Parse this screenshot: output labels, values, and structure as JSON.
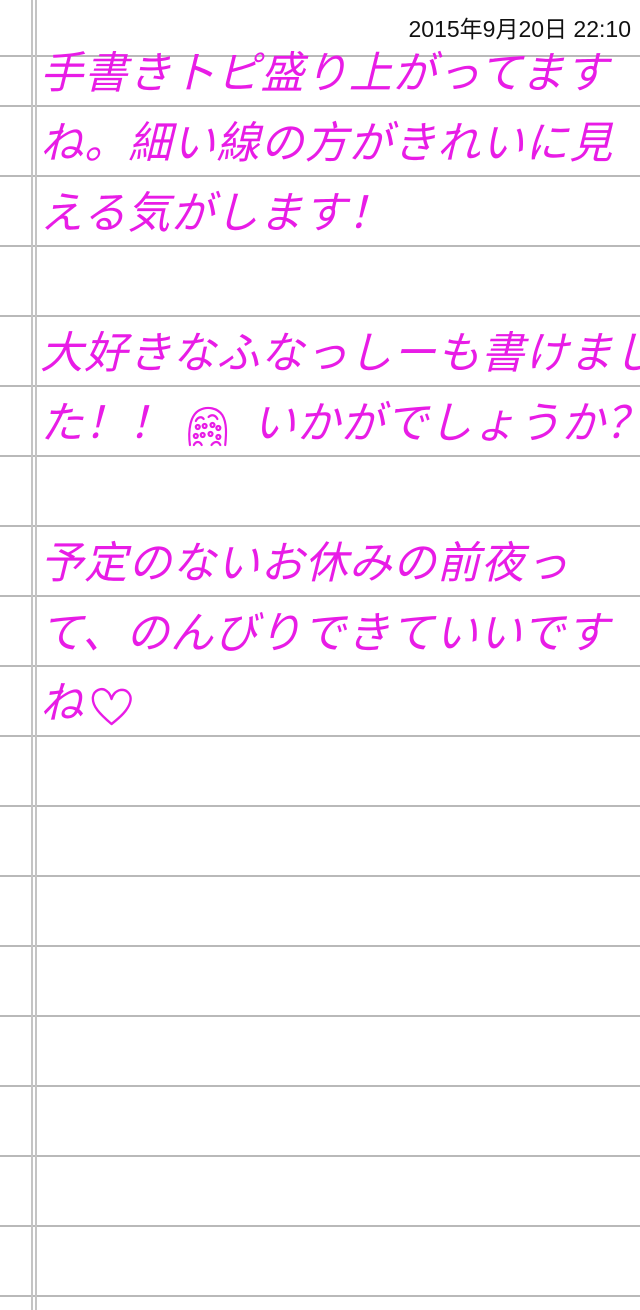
{
  "header": {
    "timestamp": "2015年9月20日 22:10"
  },
  "note": {
    "ink_color": "#e81ce6",
    "paragraph1": {
      "line1": "手書きトピ盛り上がってます",
      "line2": "ね。細い線の方がきれいに見",
      "line3": "える気がします！"
    },
    "paragraph2": {
      "line1": "大好きなふなっしーも書けまし",
      "line2_before_icon": "た！！",
      "line2_icon": "funassyi-doodle-icon",
      "line2_after_icon": "いかがでしょうか？"
    },
    "paragraph3": {
      "line1": "予定のないお休みの前夜っ",
      "line2": "て、のんびりできていいです",
      "line3_text": "ね",
      "line3_icon": "heart-icon"
    }
  }
}
